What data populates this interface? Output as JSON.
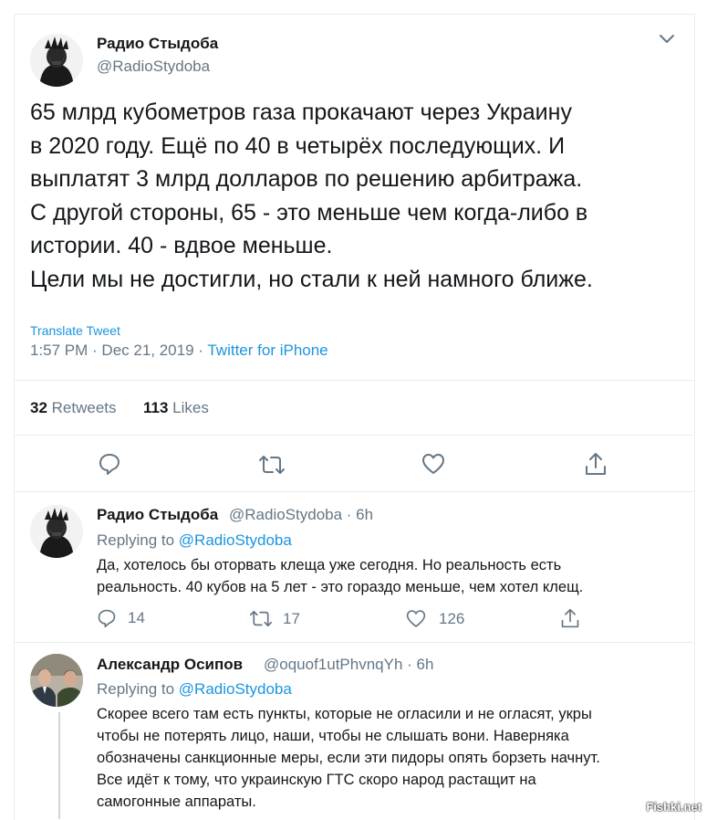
{
  "main_tweet": {
    "name": "Радио Стыдоба",
    "handle": "@RadioStydoba",
    "text_lines": [
      "65 млрд кубометров газа прокачают через Украину",
      "в 2020 году. Ещё по 40 в четырёх последующих. И",
      "выплатят 3 млрд долларов по решению арбитража.",
      "С другой стороны, 65 - это меньше чем когда-либо в",
      "истории. 40 - вдвое меньше.",
      "Цели мы не достигли, но стали к ней намного ближе."
    ],
    "translate_label": "Translate Tweet",
    "timestamp": "1:57 PM · Dec 21, 2019 · ",
    "source": "Twitter for iPhone",
    "retweets_count": "32",
    "retweets_label": "Retweets",
    "likes_count": "113",
    "likes_label": "Likes"
  },
  "replies": [
    {
      "name": "Радио Стыдоба",
      "handle_time": "@RadioStydoba · 6h",
      "replying_prefix": "Replying to ",
      "replying_handle": "@RadioStydoba",
      "text_lines": [
        "Да, хотелось бы оторвать клеща уже сегодня. Но реальность есть",
        "реальность. 40 кубов на 5 лет - это гораздо меньше, чем хотел клещ."
      ],
      "reply_count": "14",
      "retweet_count": "17",
      "like_count": "126"
    },
    {
      "name": "Александр Осипов",
      "handle_time": "@oquof1utPhvnqYh · 6h",
      "replying_prefix": "Replying to ",
      "replying_handle": "@RadioStydoba",
      "text_lines": [
        "Скорее всего там есть пункты, которые не огласили и не огласят, укры",
        "чтобы не потерять лицо, наши, чтобы не слышать вони. Наверняка",
        "обозначены санкционные меры, если эти пидоры опять борзеть начнут.",
        "Все идёт к тому, что украинскую ГТС скоро народ растащит на",
        "самогонные аппараты."
      ]
    }
  ],
  "watermark": "Fishki.net",
  "colors": {
    "accent": "#1b95e0",
    "muted": "#657786",
    "text": "#14171a",
    "border": "#e6ecf0"
  }
}
